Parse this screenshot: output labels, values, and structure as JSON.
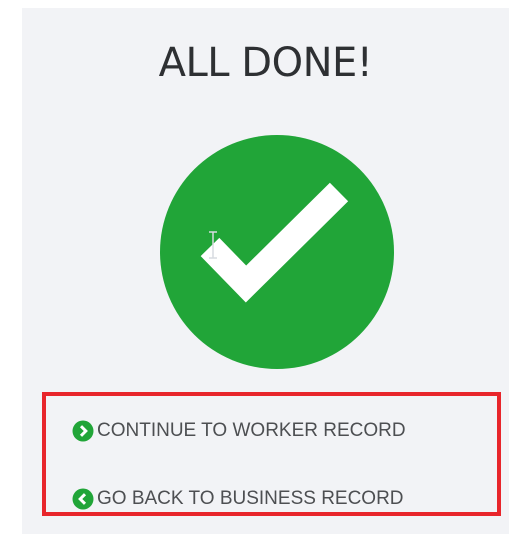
{
  "page": {
    "title": "ALL DONE!"
  },
  "status": {
    "icon": "checkmark-circle-icon",
    "color": "#21a538"
  },
  "actions": {
    "continue_label": "CONTINUE TO WORKER RECORD",
    "continue_icon": "chevron-right-circle-icon",
    "back_label": "GO BACK TO BUSINESS RECORD",
    "back_icon": "chevron-left-circle-icon",
    "highlight_color": "#e8252b",
    "icon_color": "#21a538"
  }
}
